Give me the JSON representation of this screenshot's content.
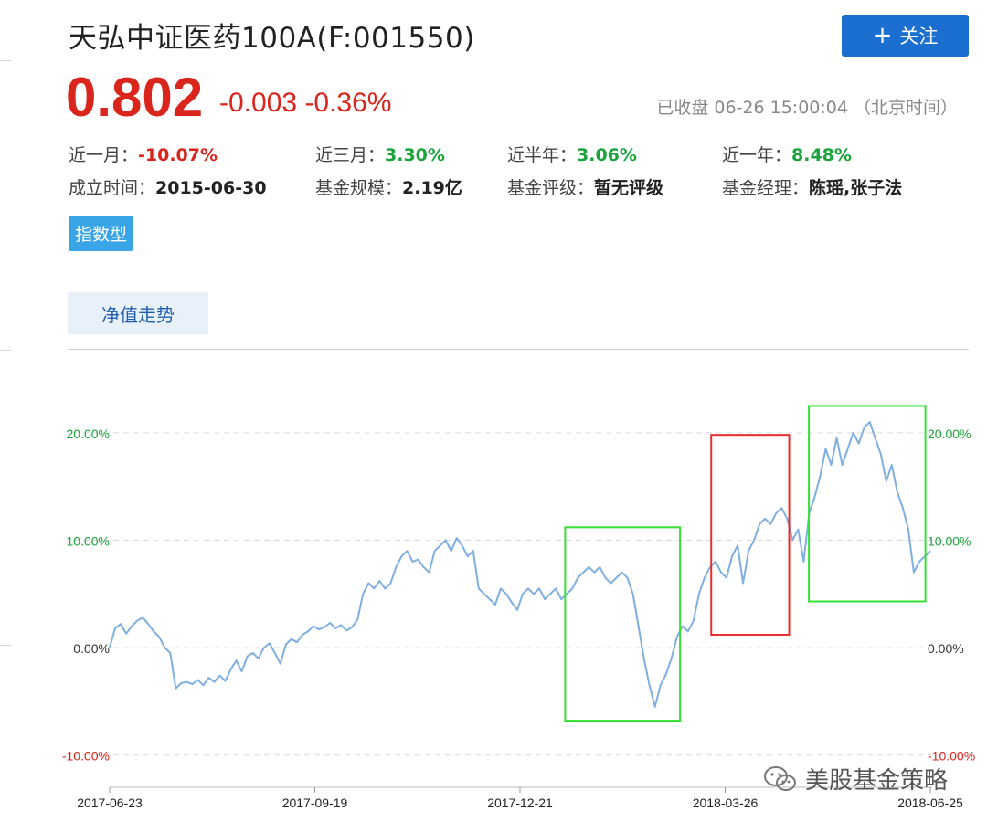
{
  "header": {
    "title": "天弘中证医药100A(F:001550)",
    "follow_label": "关注",
    "price": "0.802",
    "change": "-0.003 -0.36%",
    "status": "已收盘 06-26 15:00:04 （北京时间）"
  },
  "stats": {
    "row1": [
      {
        "label": "近一月：",
        "value": "-10.07%"
      },
      {
        "label": "近三月：",
        "value": "3.30%"
      },
      {
        "label": "近半年：",
        "value": "3.06%"
      },
      {
        "label": "近一年：",
        "value": "8.48%"
      }
    ],
    "row2": [
      {
        "label": "成立时间：",
        "value": "2015-06-30"
      },
      {
        "label": "基金规模：",
        "value": "2.19亿"
      },
      {
        "label": "基金评级：",
        "value": "暂无评级"
      },
      {
        "label": "基金经理：",
        "value": "陈瑶,张子法"
      }
    ]
  },
  "tag": "指数型",
  "tab": "净值走势",
  "watermark": "美股基金策略",
  "colors": {
    "up": "#d9251c",
    "down": "#1aa33a",
    "line": "#7fafe0",
    "accent": "#1a6fd1",
    "box_green": "#33e033",
    "box_red": "#e62c2c"
  },
  "chart_data": {
    "type": "line",
    "x_ticks": [
      "2017-06-23",
      "2017-09-19",
      "2017-12-21",
      "2018-03-26",
      "2018-06-25"
    ],
    "y_ticks": [
      {
        "value": 20,
        "left": "20.00%",
        "right": "20.00%"
      },
      {
        "value": 10,
        "left": "10.00%",
        "right": "10.00%"
      },
      {
        "value": 0,
        "left": "0.00%",
        "right": "0.00%"
      },
      {
        "value": -10,
        "left": "-10.00%",
        "right": "-10.00%"
      }
    ],
    "ylim": [
      -13,
      25
    ],
    "grid": true,
    "series": [
      {
        "values": [
          0,
          1.8,
          2.2,
          1.3,
          2.0,
          2.5,
          2.8,
          2.2,
          1.5,
          1.0,
          0.0,
          -0.5,
          -3.8,
          -3.3,
          -3.2,
          -3.4,
          -3.0,
          -3.5,
          -2.8,
          -3.2,
          -2.6,
          -3.1,
          -2.0,
          -1.2,
          -2.2,
          -0.8,
          -0.5,
          -1.0,
          0.0,
          0.4,
          -0.5,
          -1.5,
          0.3,
          0.8,
          0.5,
          1.2,
          1.5,
          2.0,
          1.7,
          1.9,
          2.3,
          1.8,
          2.1,
          1.6,
          1.9,
          2.6,
          5.0,
          6.0,
          5.5,
          6.2,
          5.5,
          6.0,
          7.5,
          8.5,
          9.0,
          8.0,
          8.2,
          7.5,
          7.0,
          9.0,
          9.5,
          10.0,
          9.0,
          10.2,
          9.5,
          8.5,
          9.0,
          5.5,
          5.0,
          4.5,
          4.0,
          5.5,
          5.0,
          4.2,
          3.5,
          5.0,
          5.5,
          5.0,
          5.5,
          4.5,
          5.0,
          5.5,
          4.5,
          5.0,
          5.5,
          6.5,
          7.0,
          7.5,
          7.0,
          7.5,
          6.5,
          6.0,
          6.5,
          7.0,
          6.5,
          5.0,
          2.0,
          -1.0,
          -3.5,
          -5.5,
          -3.5,
          -2.5,
          -1.0,
          1.0,
          2.0,
          1.5,
          2.5,
          5.0,
          6.5,
          7.5,
          8.0,
          7.0,
          6.5,
          8.5,
          9.5,
          6.0,
          9.0,
          10.0,
          11.5,
          12.0,
          11.5,
          12.5,
          13.0,
          12.0,
          10.0,
          11.0,
          8.0,
          12.5,
          14.0,
          16.0,
          18.5,
          17.0,
          19.5,
          17.0,
          18.5,
          20.0,
          19.0,
          20.5,
          21.0,
          19.5,
          18.0,
          15.5,
          17.0,
          14.5,
          13.0,
          11.0,
          7.0,
          8.0,
          8.5,
          9.0
        ]
      }
    ],
    "highlights": [
      {
        "color": "green",
        "x_range": [
          0.555,
          0.695
        ],
        "y_range": [
          -6.8,
          11.2
        ]
      },
      {
        "color": "red",
        "x_range": [
          0.733,
          0.828
        ],
        "y_range": [
          1.2,
          19.8
        ]
      },
      {
        "color": "green",
        "x_range": [
          0.852,
          0.994
        ],
        "y_range": [
          4.3,
          22.5
        ]
      }
    ]
  }
}
